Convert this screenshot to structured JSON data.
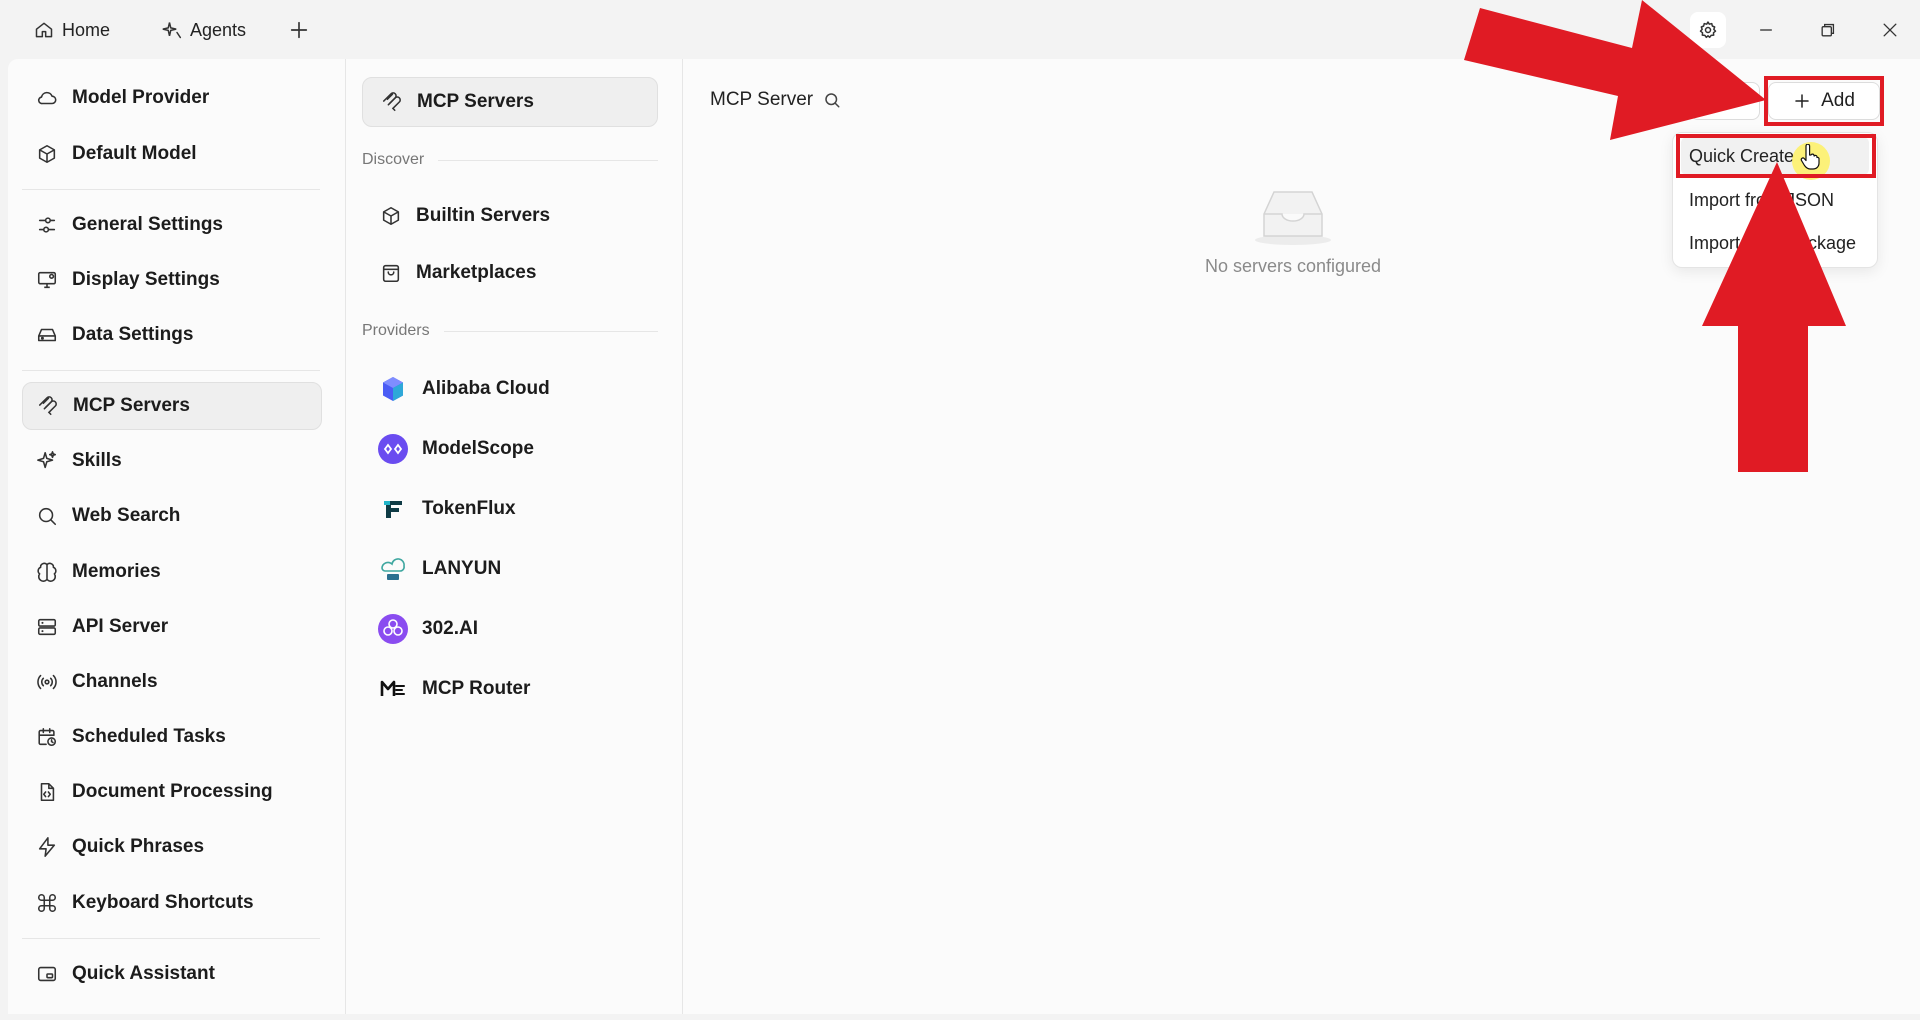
{
  "titlebar": {
    "tabs": [
      {
        "label": "Home",
        "icon": "home-icon"
      },
      {
        "label": "Agents",
        "icon": "sparkle-icon"
      }
    ]
  },
  "nav": {
    "items": [
      {
        "label": "Model Provider",
        "icon": "cloud-icon"
      },
      {
        "label": "Default Model",
        "icon": "cube-icon"
      },
      {
        "label": "General Settings",
        "icon": "sliders-icon"
      },
      {
        "label": "Display Settings",
        "icon": "monitor-icon"
      },
      {
        "label": "Data Settings",
        "icon": "drive-icon"
      },
      {
        "label": "MCP Servers",
        "icon": "mcp-icon",
        "active": true
      },
      {
        "label": "Skills",
        "icon": "sparkles-icon"
      },
      {
        "label": "Web Search",
        "icon": "search-icon"
      },
      {
        "label": "Memories",
        "icon": "brain-icon"
      },
      {
        "label": "API Server",
        "icon": "server-icon"
      },
      {
        "label": "Channels",
        "icon": "broadcast-icon"
      },
      {
        "label": "Scheduled Tasks",
        "icon": "calendar-clock-icon"
      },
      {
        "label": "Document Processing",
        "icon": "file-code-icon"
      },
      {
        "label": "Quick Phrases",
        "icon": "zap-icon"
      },
      {
        "label": "Keyboard Shortcuts",
        "icon": "command-icon"
      },
      {
        "label": "Quick Assistant",
        "icon": "window-icon"
      }
    ]
  },
  "mid": {
    "top": {
      "label": "MCP Servers",
      "icon": "mcp-icon"
    },
    "discover_label": "Discover",
    "discover": [
      {
        "label": "Builtin Servers",
        "icon": "cube-icon"
      },
      {
        "label": "Marketplaces",
        "icon": "shopping-bag-icon"
      }
    ],
    "providers_label": "Providers",
    "providers": [
      {
        "label": "Alibaba Cloud",
        "icon": "alibaba-cloud-logo-icon",
        "color": "#5b6cff"
      },
      {
        "label": "ModelScope",
        "icon": "modelscope-logo-icon",
        "color": "#6a4cf0"
      },
      {
        "label": "TokenFlux",
        "icon": "tokenflux-logo-icon",
        "color": "#0f3b45"
      },
      {
        "label": "LANYUN",
        "icon": "lanyun-logo-icon",
        "color": "#3fa7a0"
      },
      {
        "label": "302.AI",
        "icon": "302ai-logo-icon",
        "color": "#8a4cf0"
      },
      {
        "label": "MCP Router",
        "icon": "mcp-router-logo-icon",
        "color": "#111111"
      }
    ]
  },
  "content": {
    "title": "MCP Server",
    "empty_text": "No servers configured",
    "add_label": "Add",
    "menu": [
      "Quick Create",
      "Import from JSON",
      "Import from Package"
    ]
  },
  "colors": {
    "annotation_red": "#e01b24",
    "cursor_highlight": "#fff050"
  }
}
